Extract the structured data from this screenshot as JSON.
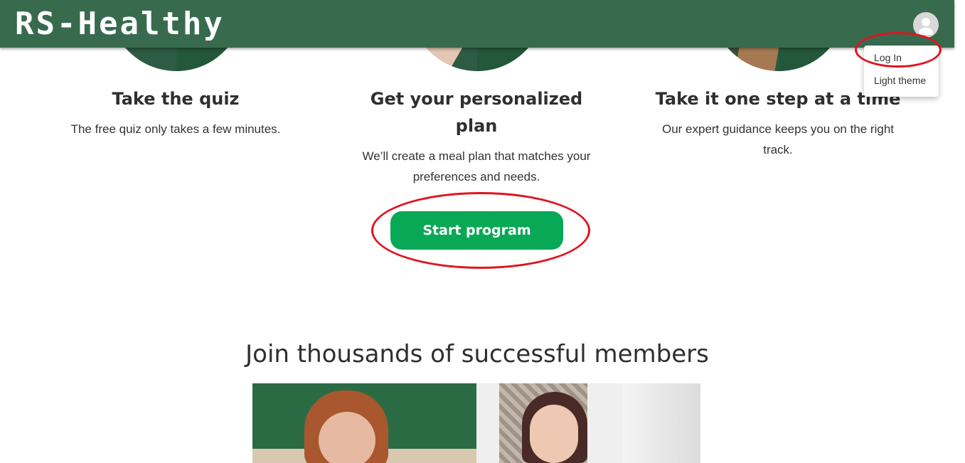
{
  "header": {
    "brand": "RS-Healthy",
    "avatar_icon": "account-circle-icon",
    "background": "#386a4e"
  },
  "user_menu": {
    "items": [
      {
        "label": "Log In"
      },
      {
        "label": "Light theme"
      }
    ]
  },
  "steps": [
    {
      "title": "Take the quiz",
      "text": "The free quiz only takes a few minutes."
    },
    {
      "title": "Get your personalized plan",
      "text": "We’ll create a meal plan that matches your preferences and needs."
    },
    {
      "title": "Take it one step at a time",
      "text": "Our expert guidance keeps you on the right track."
    }
  ],
  "cta": {
    "label": "Start program",
    "color": "#08a856"
  },
  "members": {
    "title": "Join thousands of successful members"
  },
  "annotation_color": "#e0141e"
}
